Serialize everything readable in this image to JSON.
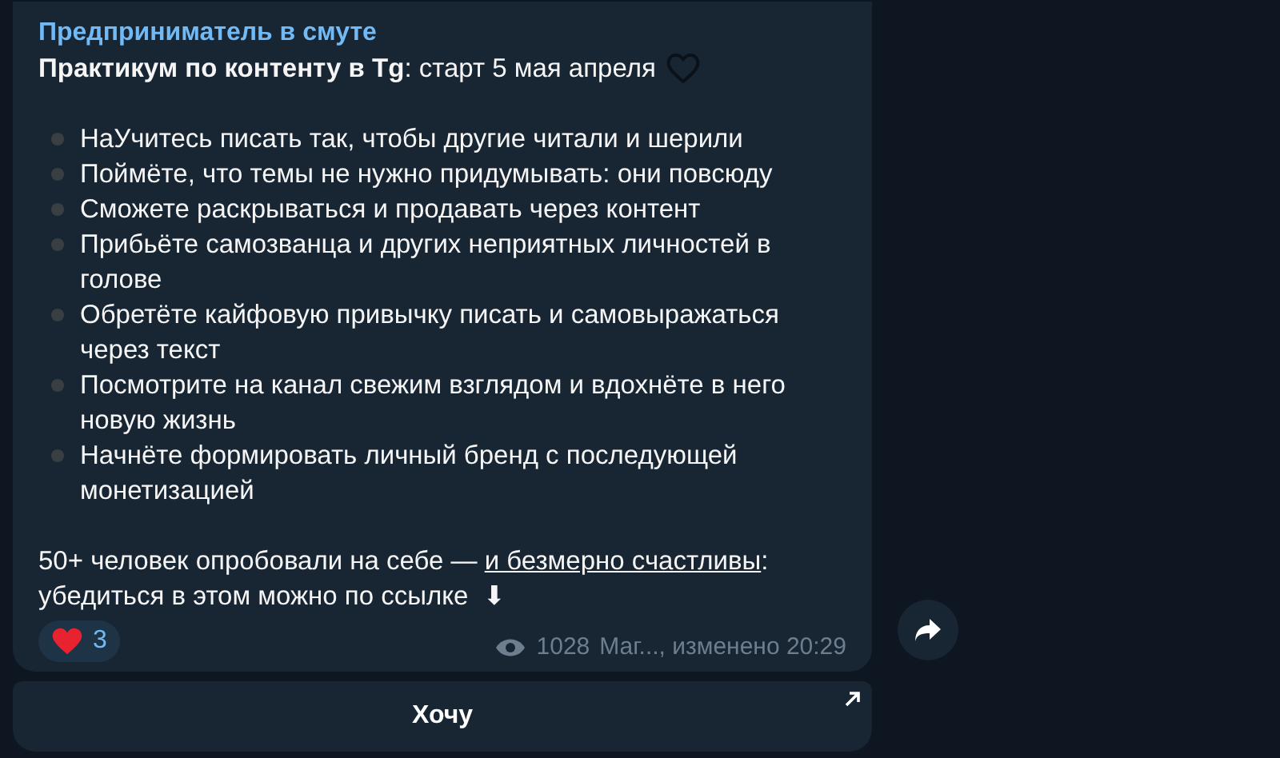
{
  "channel_name": "Предприниматель в смуте",
  "headline": "**Практикум по контенту в Tg**: старт 5 мая апреля",
  "items": [
    "НаУчитесь писать так, чтобы другие читали и шерили",
    "Поймёте, что темы не нужно придумывать: они повсюду",
    "Сможете раскрываться и продавать через контент",
    "Прибьёте самозванца и других неприятных личностей в голове",
    "Обретёте кайфовую привычку писать и самовыражаться через текст",
    "Посмотрите на канал свежим взглядом и вдохнёте в него новую жизнь",
    "Начнёте формировать личный бренд с последующей монетизацией"
  ],
  "footer": {
    "before": "50+ человек опробовали на себе — ",
    "link": "и безмерно счастливы",
    "after": ": убедиться в этом можно по ссылке  ⬇"
  },
  "reaction": {
    "count": "3"
  },
  "views": "1028",
  "meta": "Маг..., изменено 20:29",
  "button": "Хочу"
}
